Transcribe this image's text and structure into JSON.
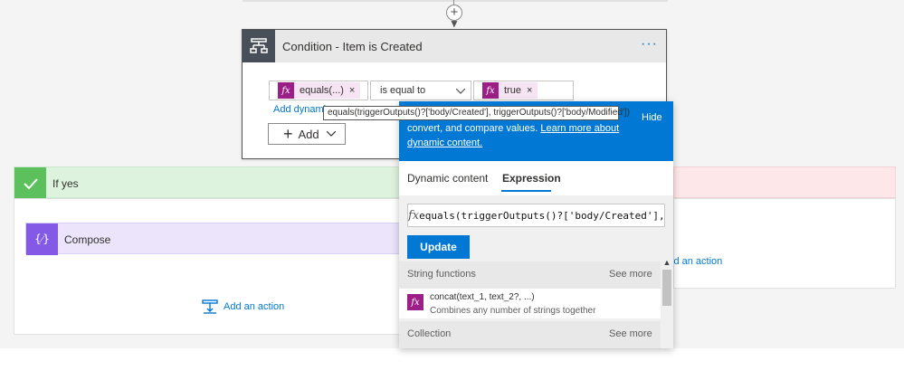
{
  "condition": {
    "title": "Condition - Item is Created",
    "more": "···",
    "left_token": "equals(...)",
    "token_x": "×",
    "operator": "is equal to",
    "right_token": "true",
    "add_dynamic": "Add dynamic",
    "add_button": "Add"
  },
  "tooltip": "equals(triggerOutputs()?['body/Created'], triggerOutputs()?['body/Modified'])",
  "if_yes": {
    "label": "If yes",
    "compose_label": "Compose",
    "add_action": "Add an action"
  },
  "if_no": {
    "add_action": "Add an action"
  },
  "panel": {
    "intro_text": "convert, and compare values.",
    "learn_more": "Learn more about dynamic content.",
    "hide": "Hide",
    "tab_dynamic": "Dynamic content",
    "tab_expression": "Expression",
    "expression_value": "equals(triggerOutputs()?['body/Created'],",
    "update": "Update",
    "sections": [
      {
        "label": "String functions",
        "see_more": "See more"
      },
      {
        "label": "Collection",
        "see_more": "See more"
      }
    ],
    "function": {
      "name": "concat(text_1, text_2?, ...)",
      "description": "Combines any number of strings together"
    }
  },
  "colors": {
    "accent": "#0078d4",
    "fx": "#9b1f86",
    "yes": "#5cc05c",
    "compose": "#8459e6"
  },
  "icons": {
    "condition": "condition-icon",
    "fx": "fx-icon",
    "check": "check-icon",
    "compose": "compose-icon",
    "add": "plus-icon",
    "chevron": "chevron-down-icon"
  }
}
